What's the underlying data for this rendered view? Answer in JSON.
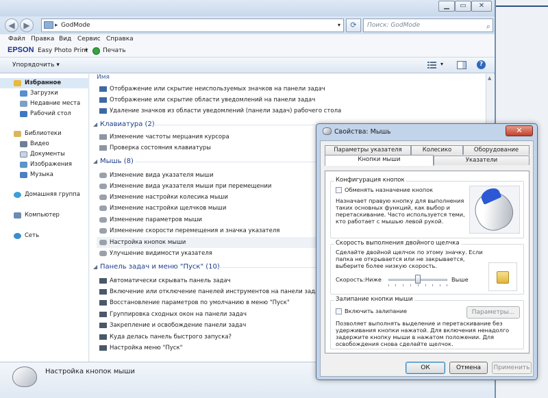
{
  "explorer": {
    "address": "GodMode",
    "search_placeholder": "Поиск: GodMode",
    "menu": [
      "Файл",
      "Правка",
      "Вид",
      "Сервис",
      "Справка"
    ],
    "epson": {
      "brand": "EPSON",
      "app": "Easy Photo Print",
      "print": "Печать"
    },
    "organize": "Упорядочить",
    "nav": {
      "favorites": "Избранное",
      "favorites_items": [
        "Загрузки",
        "Недавние места",
        "Рабочий стол"
      ],
      "libraries": "Библиотеки",
      "libraries_items": [
        "Видео",
        "Документы",
        "Изображения",
        "Музыка"
      ],
      "homegroup": "Домашняя группа",
      "computer": "Компьютер",
      "network": "Сеть"
    },
    "column_header": "Имя",
    "items_top": [
      "Отображение или скрытие неиспользуемых значков на панели задач",
      "Отображение или скрытие области уведомлений на панели задач",
      "Удаление значков из области уведомлений (панели задач) рабочего стола"
    ],
    "group_keyboard": "Клавиатура (2)",
    "items_keyboard": [
      "Изменение частоты мерцания курсора",
      "Проверка состояния клавиатуры"
    ],
    "group_mouse": "Мышь (8)",
    "items_mouse": [
      "Изменение вида указателя мыши",
      "Изменение вида указателя мыши при перемещении",
      "Изменение настройки колесика мыши",
      "Изменение настройки щелчков мыши",
      "Изменение параметров мыши",
      "Изменение скорости перемещения и значка указателя",
      "Настройка кнопок мыши",
      "Улучшение видимости указателя"
    ],
    "group_taskbar": "Панель задач и меню \"Пуск\" (10)",
    "items_taskbar": [
      "Автоматически скрывать панель задач",
      "Включение или отключение панелей инструментов на панели задач",
      "Восстановление параметров по умолчанию в меню \"Пуск\"",
      "Группировка сходных окон на панели задач",
      "Закрепление и освобождение панели задач",
      "Куда делась панель быстрого запуска?",
      "Настройка меню \"Пуск\""
    ],
    "details_text": "Настройка кнопок мыши"
  },
  "dialog": {
    "title": "Свойства: Мышь",
    "close": "✕",
    "tabs_row1": [
      "Параметры указателя",
      "Колесико",
      "Оборудование"
    ],
    "tabs_row2": [
      "Кнопки мыши",
      "Указатели"
    ],
    "group1": {
      "title": "Конфигурация кнопок",
      "checkbox": "Обменять назначение кнопок",
      "desc": [
        "Назначает правую кнопку для выполнения",
        "таких основных функций, как выбор и",
        "перетаскивание. Часто используется теми,",
        "кто работает с мышью левой рукой."
      ]
    },
    "group2": {
      "title": "Скорость выполнения двойного щелчка",
      "desc": [
        "Сделайте двойной щелчок по этому значку. Если",
        "папка не открывается или не закрывается,",
        "выберите более низкую скорость."
      ],
      "speed_label": "Скорость:",
      "slow": "Ниже",
      "fast": "Выше",
      "speed_value": 0.5
    },
    "group3": {
      "title": "Залипание кнопки мыши",
      "checkbox": "Включить залипание",
      "params_button": "Параметры...",
      "desc": [
        "Позволяет выполнять выделение и перетаскивание без",
        "удерживания кнопки нажатой. Для включения ненадолго",
        "задержите кнопку мыши в нажатом положении. Для",
        "освобождения снова сделайте щелчок."
      ]
    },
    "ok": "ОК",
    "cancel": "Отмена",
    "apply": "Применить"
  },
  "colors": {
    "accent": "#1d3c8a",
    "selection": "#dbe8f6",
    "close_red": "#c0412c",
    "mouse_button_blue": "#2d58d4"
  }
}
